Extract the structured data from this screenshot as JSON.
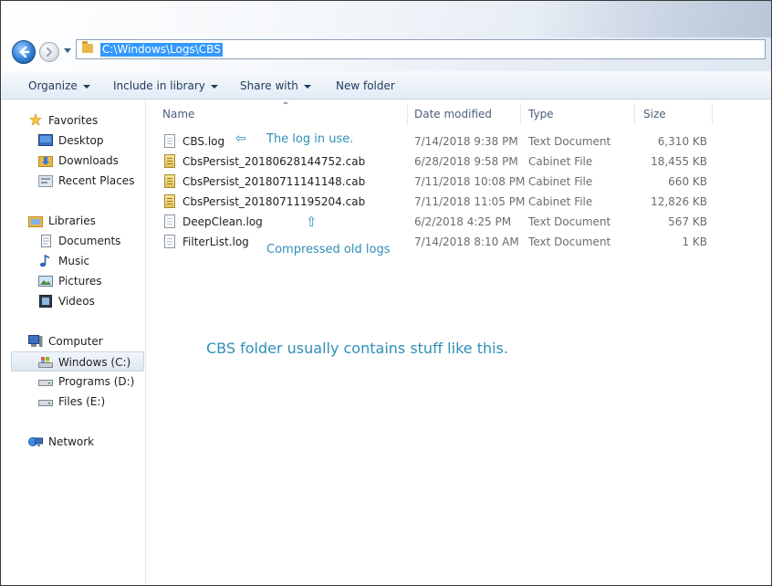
{
  "address": {
    "path": "C:\\Windows\\Logs\\CBS"
  },
  "toolbar": {
    "organize_label": "Organize",
    "include_label": "Include in library",
    "share_label": "Share with",
    "new_folder_label": "New folder"
  },
  "sidebar": {
    "favorites_label": "Favorites",
    "desktop_label": "Desktop",
    "downloads_label": "Downloads",
    "recent_label": "Recent Places",
    "libraries_label": "Libraries",
    "documents_label": "Documents",
    "music_label": "Music",
    "pictures_label": "Pictures",
    "videos_label": "Videos",
    "computer_label": "Computer",
    "windows_label": "Windows (C:)",
    "programs_label": "Programs (D:)",
    "files_label": "Files (E:)",
    "network_label": "Network"
  },
  "columns": {
    "name": "Name",
    "date": "Date modified",
    "type": "Type",
    "size": "Size"
  },
  "files": [
    {
      "name": "CBS.log",
      "date": "7/14/2018 9:38 PM",
      "type": "Text Document",
      "size": "6,310 KB",
      "kind": "text"
    },
    {
      "name": "CbsPersist_20180628144752.cab",
      "date": "6/28/2018 9:58 PM",
      "type": "Cabinet File",
      "size": "18,455 KB",
      "kind": "cab"
    },
    {
      "name": "CbsPersist_20180711141148.cab",
      "date": "7/11/2018 10:08 PM",
      "type": "Cabinet File",
      "size": "660 KB",
      "kind": "cab"
    },
    {
      "name": "CbsPersist_20180711195204.cab",
      "date": "7/11/2018 11:05 PM",
      "type": "Cabinet File",
      "size": "12,826 KB",
      "kind": "cab"
    },
    {
      "name": "DeepClean.log",
      "date": "6/2/2018 4:25 PM",
      "type": "Text Document",
      "size": "567 KB",
      "kind": "text"
    },
    {
      "name": "FilterList.log",
      "date": "7/14/2018 8:10 AM",
      "type": "Text Document",
      "size": "1 KB",
      "kind": "text"
    }
  ],
  "annotations": {
    "log_in_use": "The log in use.",
    "left_arrow": "⇦",
    "up_arrow": "⇧",
    "compressed": "Compressed old logs",
    "caption": "CBS folder usually contains stuff like this."
  },
  "colors": {
    "annotation": "#2f8fb8",
    "selection": "#3399ff"
  }
}
